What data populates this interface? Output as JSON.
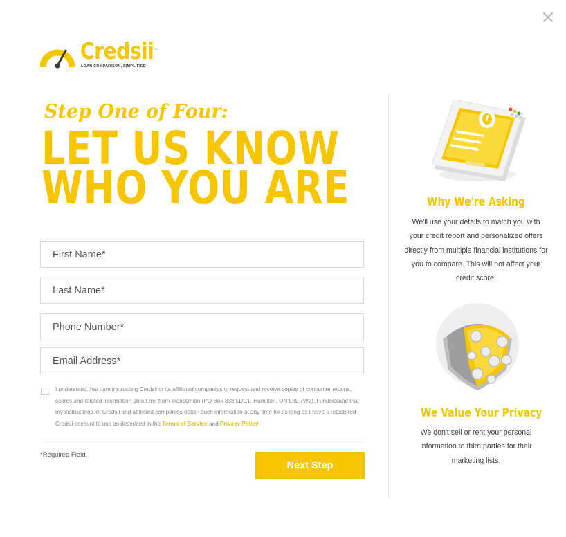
{
  "close": {
    "glyph": "×"
  },
  "logo": {
    "name": "Credsii",
    "tagline": "LOAN COMPARISON, SIMPLIFIED",
    "trademark": "™"
  },
  "step_label": "Step One of Four:",
  "headline": {
    "line1": "LET US KNOW",
    "line2": "WHO YOU ARE"
  },
  "form": {
    "first_name_placeholder": "First Name*",
    "last_name_placeholder": "Last Name*",
    "phone_placeholder": "Phone Number*",
    "email_placeholder": "Email Address*",
    "consent_text": "I understand that I am instructing Credsii or its affiliated companies to request and receive copies of consumer reports, scores and related information about me from TransUnion (PO Box 338 LDC1, Hamilton, ON L8L 7W2). I understand that my instructions let Credsii and affiliated companies obtain such information at any time for as long as I have a registered Credsii account to use as described in the",
    "terms_link": "Terms of Service",
    "and_text": "and",
    "privacy_link": "Privacy Policy",
    "period": ".",
    "required_note": "*Required Field.",
    "next_label": "Next Step"
  },
  "sidebar": {
    "why_title": "Why We're Asking",
    "why_text": "We'll use your details to match you with your credit report and personalized offers directly from multiple financial institutions for you to compare. This will not affect your credit score.",
    "privacy_title": "We Value Your Privacy",
    "privacy_text": "We don't sell or rent your personal information to third parties for their marketing lists."
  },
  "colors": {
    "brand": "#f7c600",
    "text": "#444444",
    "border": "#dcdcdc"
  },
  "icons": [
    "close-icon",
    "speedometer-icon",
    "login-form-illustration",
    "shield-illustration"
  ]
}
